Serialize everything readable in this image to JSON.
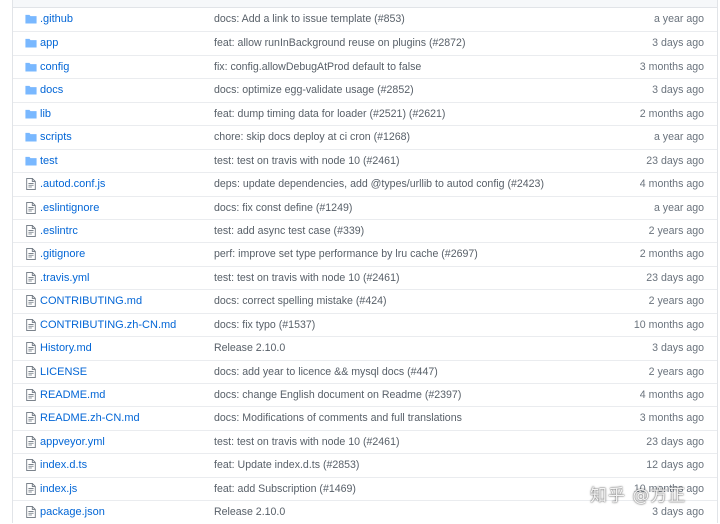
{
  "colors": {
    "link": "#0366d6",
    "folder_icon": "#79b8ff",
    "file_icon": "#6a737d",
    "muted_text": "#586069"
  },
  "files": [
    {
      "name": ".github",
      "type": "folder",
      "icon": "folder-icon",
      "message": "docs: Add a link to issue template (#853)",
      "age": "a year ago"
    },
    {
      "name": "app",
      "type": "folder",
      "icon": "folder-icon",
      "message": "feat: allow runInBackground reuse on plugins (#2872)",
      "age": "3 days ago"
    },
    {
      "name": "config",
      "type": "folder",
      "icon": "folder-icon",
      "message": "fix: config.allowDebugAtProd default to false",
      "age": "3 months ago"
    },
    {
      "name": "docs",
      "type": "folder",
      "icon": "folder-icon",
      "message": "docs: optimize egg-validate usage (#2852)",
      "age": "3 days ago"
    },
    {
      "name": "lib",
      "type": "folder",
      "icon": "folder-icon",
      "message": "feat: dump timing data for loader (#2521) (#2621)",
      "age": "2 months ago"
    },
    {
      "name": "scripts",
      "type": "folder",
      "icon": "folder-icon",
      "message": "chore: skip docs deploy at ci cron (#1268)",
      "age": "a year ago"
    },
    {
      "name": "test",
      "type": "folder",
      "icon": "folder-icon",
      "message": "test: test on travis with node 10 (#2461)",
      "age": "23 days ago"
    },
    {
      "name": ".autod.conf.js",
      "type": "file",
      "icon": "file-icon",
      "message": "deps: update dependencies, add @types/urllib to autod config (#2423)",
      "age": "4 months ago"
    },
    {
      "name": ".eslintignore",
      "type": "file",
      "icon": "file-icon",
      "message": "docs: fix const define (#1249)",
      "age": "a year ago"
    },
    {
      "name": ".eslintrc",
      "type": "file",
      "icon": "file-icon",
      "message": "test: add async test case (#339)",
      "age": "2 years ago"
    },
    {
      "name": ".gitignore",
      "type": "file",
      "icon": "file-icon",
      "message": "perf: improve set type performance by lru cache (#2697)",
      "age": "2 months ago"
    },
    {
      "name": ".travis.yml",
      "type": "file",
      "icon": "file-icon",
      "message": "test: test on travis with node 10 (#2461)",
      "age": "23 days ago"
    },
    {
      "name": "CONTRIBUTING.md",
      "type": "file",
      "icon": "file-icon",
      "message": "docs: correct spelling mistake (#424)",
      "age": "2 years ago"
    },
    {
      "name": "CONTRIBUTING.zh-CN.md",
      "type": "file",
      "icon": "file-icon",
      "message": "docs: fix typo (#1537)",
      "age": "10 months ago"
    },
    {
      "name": "History.md",
      "type": "file",
      "icon": "file-icon",
      "message": "Release 2.10.0",
      "age": "3 days ago"
    },
    {
      "name": "LICENSE",
      "type": "file",
      "icon": "file-icon",
      "message": "docs: add year to licence && mysql docs (#447)",
      "age": "2 years ago"
    },
    {
      "name": "README.md",
      "type": "file",
      "icon": "file-icon",
      "message": "docs: change English document on Readme (#2397)",
      "age": "4 months ago"
    },
    {
      "name": "README.zh-CN.md",
      "type": "file",
      "icon": "file-icon",
      "message": "docs: Modifications of comments and full translations",
      "age": "3 months ago"
    },
    {
      "name": "appveyor.yml",
      "type": "file",
      "icon": "file-icon",
      "message": "test: test on travis with node 10 (#2461)",
      "age": "23 days ago"
    },
    {
      "name": "index.d.ts",
      "type": "file",
      "icon": "file-icon",
      "message": "feat: Update index.d.ts (#2853)",
      "age": "12 days ago"
    },
    {
      "name": "index.js",
      "type": "file",
      "icon": "file-icon",
      "message": "feat: add Subscription (#1469)",
      "age": "10 months ago"
    },
    {
      "name": "package.json",
      "type": "file",
      "icon": "file-icon",
      "message": "Release 2.10.0",
      "age": "3 days ago"
    }
  ],
  "watermark": "知乎 @方正"
}
